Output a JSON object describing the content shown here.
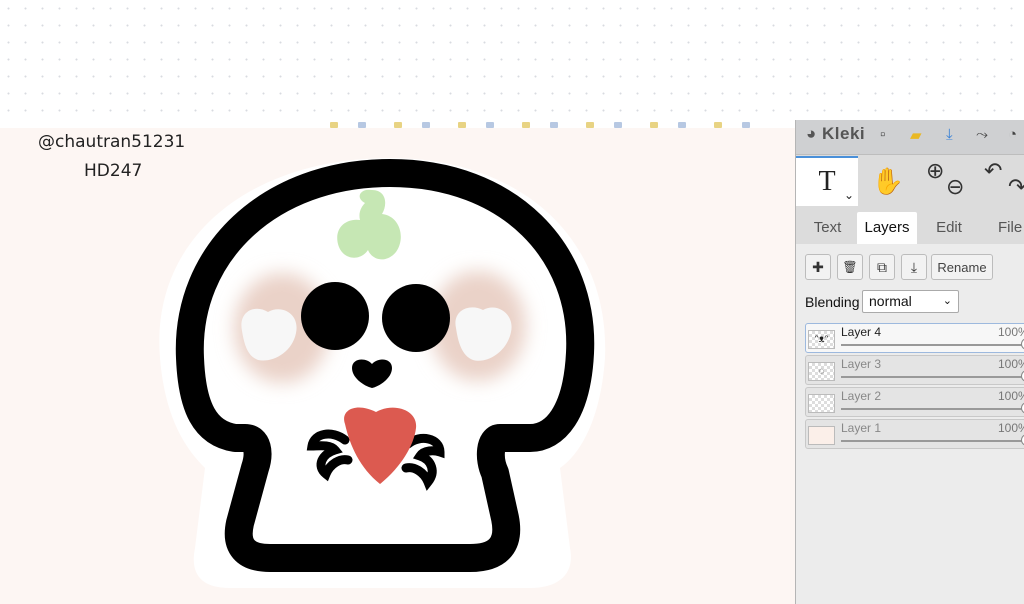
{
  "canvas": {
    "credit_user": "@chautran51231",
    "credit_code": "HD247",
    "colors": {
      "background": "#fdf6f3",
      "outline": "#000000",
      "sprout": "#c6e7b4",
      "heart": "#dc5a50",
      "blush": "#ead2c8"
    }
  },
  "panel": {
    "app_name": "Kleki",
    "header_icons": [
      "new-file-icon",
      "folder-icon",
      "download-icon",
      "share-icon",
      "help-icon"
    ],
    "tools": {
      "text_glyph": "T",
      "text_chevron": "⌄",
      "hand_glyph": "✋",
      "zoom_in": "⊕",
      "zoom_out": "⊖",
      "undo": "↶",
      "redo": "↷"
    },
    "tabs": [
      {
        "label": "Text",
        "active": false
      },
      {
        "label": "Layers",
        "active": true
      },
      {
        "label": "Edit",
        "active": false
      },
      {
        "label": "File",
        "active": false
      }
    ],
    "layer_buttons": {
      "add": "✚",
      "delete": "🗑",
      "duplicate": "⧉",
      "merge": "⤓",
      "rename": "Rename"
    },
    "blending": {
      "label": "Blending",
      "value": "normal",
      "chevron": "⌄"
    },
    "layers": [
      {
        "name": "Layer 4",
        "opacity": "100%",
        "selected": true,
        "thumb": "ᵔᴥᵔ"
      },
      {
        "name": "Layer 3",
        "opacity": "100%",
        "selected": false,
        "thumb": "◌"
      },
      {
        "name": "Layer 2",
        "opacity": "100%",
        "selected": false,
        "thumb": ""
      },
      {
        "name": "Layer 1",
        "opacity": "100%",
        "selected": false,
        "thumb": ""
      }
    ]
  }
}
